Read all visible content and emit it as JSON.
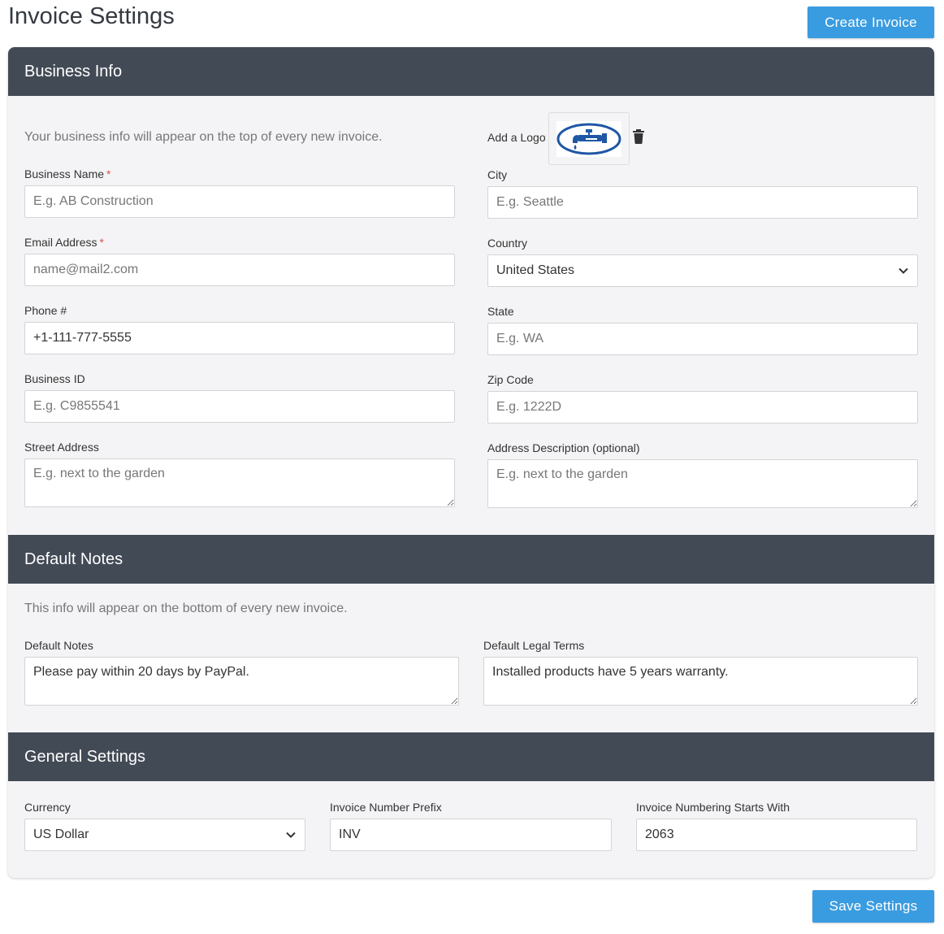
{
  "page": {
    "title": "Invoice Settings",
    "create_button": "Create Invoice",
    "save_button": "Save Settings"
  },
  "business_info": {
    "header": "Business Info",
    "description": "Your business info will appear on the top of every new invoice.",
    "logo_label": "Add a Logo",
    "business_name": {
      "label": "Business Name",
      "required": "*",
      "placeholder": "E.g. AB Construction"
    },
    "email": {
      "label": "Email Address",
      "required": "*",
      "placeholder": "name@mail2.com"
    },
    "phone": {
      "label": "Phone #",
      "value": "+1-111-777-5555"
    },
    "business_id": {
      "label": "Business ID",
      "placeholder": "E.g. C9855541"
    },
    "street": {
      "label": "Street Address",
      "placeholder": "E.g. next to the garden"
    },
    "city": {
      "label": "City",
      "placeholder": "E.g. Seattle"
    },
    "country": {
      "label": "Country",
      "value": "United States"
    },
    "state": {
      "label": "State",
      "placeholder": "E.g. WA"
    },
    "zip": {
      "label": "Zip Code",
      "placeholder": "E.g. 1222D"
    },
    "address_desc": {
      "label": "Address Description (optional)",
      "placeholder": "E.g. next to the garden"
    }
  },
  "default_notes": {
    "header": "Default Notes",
    "description": "This info will appear on the bottom of every new invoice.",
    "notes": {
      "label": "Default Notes",
      "value": "Please pay within 20 days by PayPal."
    },
    "legal": {
      "label": "Default Legal Terms",
      "value": "Installed products have 5 years warranty."
    }
  },
  "general_settings": {
    "header": "General Settings",
    "currency": {
      "label": "Currency",
      "value": "US Dollar"
    },
    "prefix": {
      "label": "Invoice Number Prefix",
      "value": "INV"
    },
    "start": {
      "label": "Invoice Numbering Starts With",
      "value": "2063"
    }
  },
  "colors": {
    "accent": "#3a9ce0",
    "header_bg": "#424a55",
    "panel_bg": "#f4f4f6",
    "required": "#d9534f",
    "logo_blue": "#1f57a5"
  },
  "icons": [
    "faucet-logo-icon",
    "trash-icon",
    "chevron-down-icon"
  ]
}
